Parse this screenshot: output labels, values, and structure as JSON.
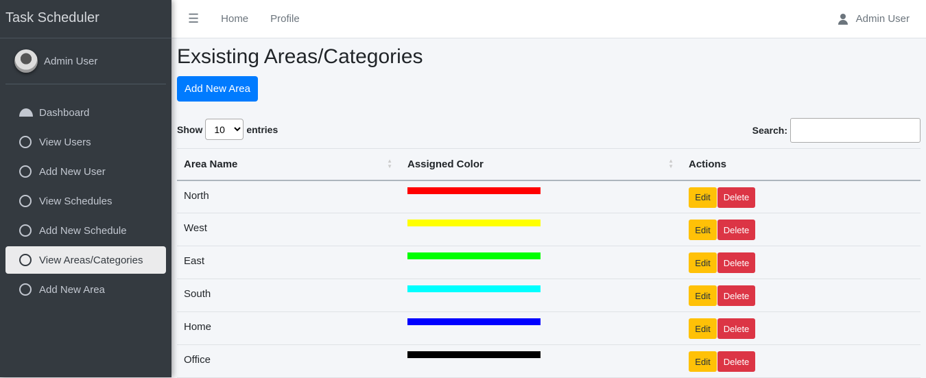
{
  "sidebar": {
    "brand": "Task Scheduler",
    "user": "Admin User",
    "items": [
      {
        "label": "Dashboard",
        "icon": "dashboard-icon"
      },
      {
        "label": "View Users"
      },
      {
        "label": "Add New User"
      },
      {
        "label": "View Schedules"
      },
      {
        "label": "Add New Schedule"
      },
      {
        "label": "View Areas/Categories",
        "active": true
      },
      {
        "label": "Add New Area"
      }
    ]
  },
  "topbar": {
    "home": "Home",
    "profile": "Profile",
    "user": "Admin User"
  },
  "page": {
    "title": "Exsisting Areas/Categories",
    "add_button": "Add New Area",
    "show": "Show",
    "entries": "entries",
    "page_size": "10",
    "search_label": "Search:",
    "search_value": ""
  },
  "table": {
    "headers": [
      "Area Name",
      "Assigned Color",
      "Actions"
    ],
    "edit": "Edit",
    "delete": "Delete",
    "rows": [
      {
        "name": "North",
        "color": "#ff0000"
      },
      {
        "name": "West",
        "color": "#ffff00"
      },
      {
        "name": "East",
        "color": "#00ff00"
      },
      {
        "name": "South",
        "color": "#00ffff"
      },
      {
        "name": "Home",
        "color": "#0000ff"
      },
      {
        "name": "Office",
        "color": "#000000"
      }
    ]
  }
}
